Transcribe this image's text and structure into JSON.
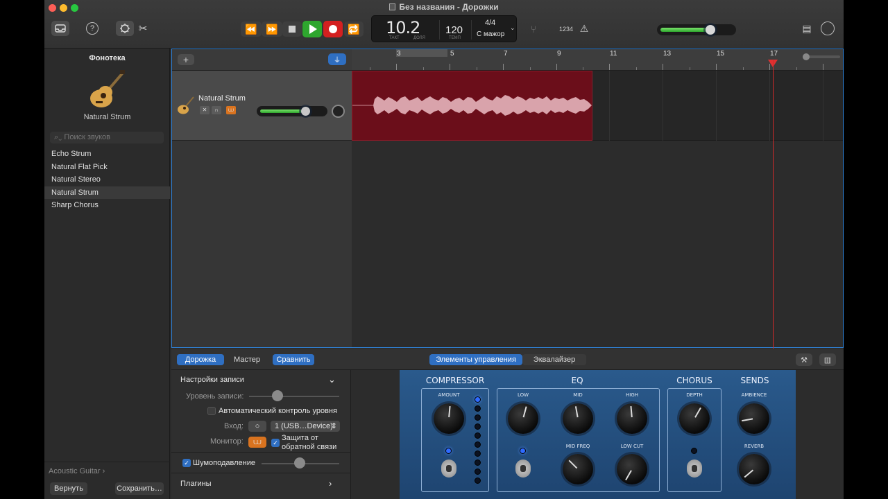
{
  "window": {
    "title": "Без названия - Дорожки"
  },
  "toolbar": {
    "help_icon": "?",
    "lcd": {
      "position": "10.2",
      "takt_label": "ТАКТ",
      "dolya_label": "ДОЛЯ",
      "tempo": "120",
      "tempo_label": "ТЕМП",
      "signature": "4/4",
      "key": "С мажор"
    },
    "count_in": "1234"
  },
  "library": {
    "title": "Фонотека",
    "instrument": "Natural Strum",
    "search_placeholder": "Поиск звуков",
    "items": [
      "Echo Strum",
      "Natural Flat Pick",
      "Natural Stereo",
      "Natural Strum",
      "Sharp Chorus"
    ],
    "selected_index": 3,
    "footer": "Acoustic Guitar",
    "revert": "Вернуть",
    "save": "Сохранить…"
  },
  "tracks": {
    "add": "+",
    "track_name": "Natural Strum",
    "volume_level": 0.68,
    "ruler": [
      "3",
      "5",
      "7",
      "9",
      "11",
      "13",
      "15",
      "17"
    ]
  },
  "smart_controls": {
    "tabs_left": [
      "Дорожка",
      "Мастер",
      "Сравнить"
    ],
    "tabs_right": [
      "Элементы управления",
      "Эквалайзер"
    ],
    "inspector": {
      "rec_settings": "Настройки записи",
      "rec_level": "Уровень записи:",
      "auto_level": "Автоматический контроль уровня",
      "input_label": "Вход:",
      "input_value": "1 (USB…Device)",
      "monitor_label": "Монитор:",
      "feedback": "Защита от обратной связи",
      "noise_gate": "Шумоподавление",
      "plugins": "Плагины"
    },
    "panel": {
      "compressor": "COMPRESSOR",
      "amount": "AMOUNT",
      "eq": "EQ",
      "low": "LOW",
      "mid": "MID",
      "high": "HIGH",
      "mid_freq": "MID FREQ",
      "low_cut": "LOW CUT",
      "chorus": "CHORUS",
      "depth": "DEPTH",
      "sends": "SENDS",
      "ambience": "AMBIENCE",
      "reverb": "REVERB"
    }
  },
  "colors": {
    "accent": "#2f6fc2",
    "region": "#6b0e1a",
    "record": "#d42020",
    "play": "#2ea62e"
  }
}
